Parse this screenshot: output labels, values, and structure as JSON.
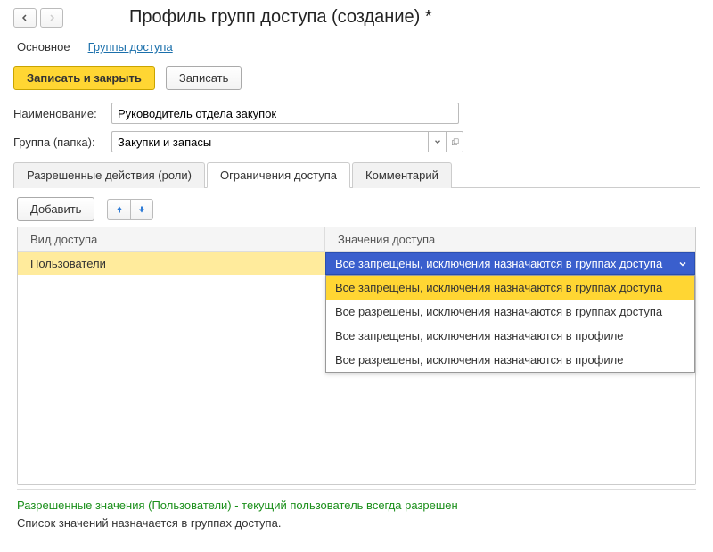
{
  "header": {
    "title": "Профиль групп доступа (создание) *"
  },
  "sectionTabs": {
    "main": "Основное",
    "groups": "Группы доступа"
  },
  "toolbar": {
    "saveClose": "Записать и закрыть",
    "save": "Записать"
  },
  "form": {
    "nameLabel": "Наименование:",
    "nameValue": "Руководитель отдела закупок",
    "groupLabel": "Группа (папка):",
    "groupValue": "Закупки и запасы"
  },
  "tabs": {
    "roles": "Разрешенные действия (роли)",
    "restrict": "Ограничения доступа",
    "comment": "Комментарий"
  },
  "subtoolbar": {
    "add": "Добавить"
  },
  "grid": {
    "colType": "Вид доступа",
    "colVal": "Значения доступа",
    "rowTypeValue": "Пользователи",
    "rowValValue": "Все запрещены, исключения назначаются в группах доступа"
  },
  "dropdown": {
    "items": [
      "Все запрещены, исключения назначаются в группах доступа",
      "Все разрешены, исключения назначаются в группах доступа",
      "Все запрещены, исключения назначаются в профиле",
      "Все разрешены, исключения назначаются в профиле"
    ]
  },
  "footer": {
    "hint1": "Разрешенные значения (Пользователи) - текущий пользователь всегда разрешен",
    "hint2": "Список значений назначается в группах доступа."
  }
}
